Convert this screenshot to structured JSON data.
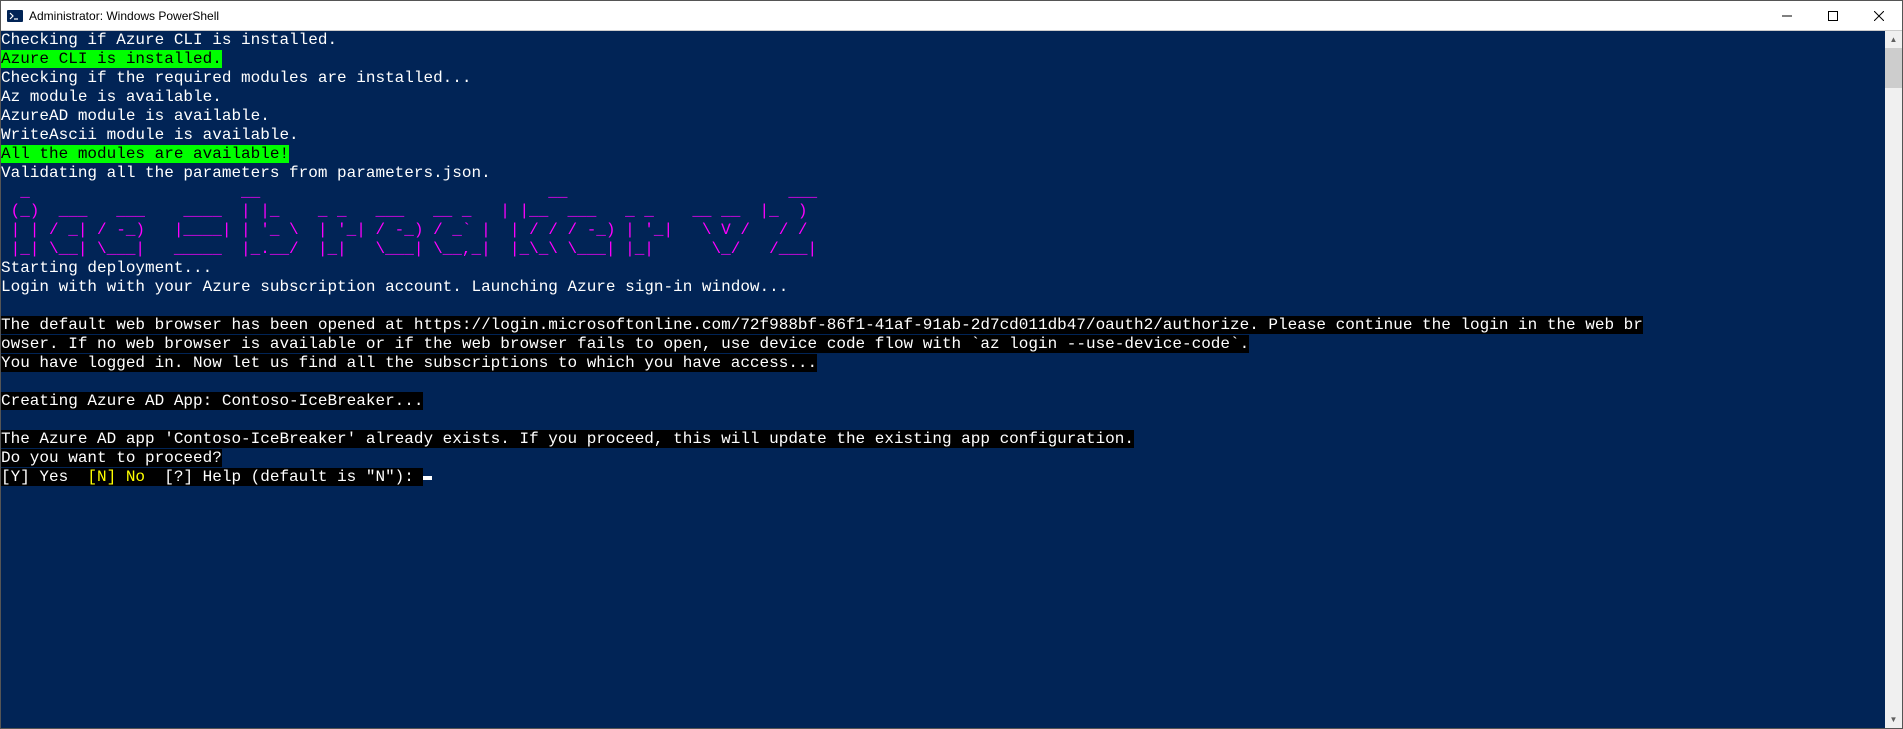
{
  "window": {
    "title": "Administrator: Windows PowerShell"
  },
  "colors": {
    "terminal_bg": "#012456",
    "terminal_fg": "#ffffff",
    "highlight_green_bg": "#00ff00",
    "highlight_green_fg": "#000000",
    "magenta": "#ff00ff",
    "black_bg": "#000000",
    "yellow": "#ffff00"
  },
  "lines": {
    "l1": "Checking if Azure CLI is installed.",
    "l2": "Azure CLI is installed.",
    "l3": "Checking if the required modules are installed...",
    "l4": "Az module is available.",
    "l5": "AzureAD module is available.",
    "l6": "WriteAscii module is available.",
    "l7": "All the modules are available!",
    "l8": "Validating all the parameters from parameters.json.",
    "ascii1": "  _                      __                              __                       ___  ",
    "ascii2": " (_)  ___   ___    ____  | |_    _ _   ___   __ _   | |__  ___   _ _    __ __  |_  ) ",
    "ascii3": " | | / _| / -_)   |____| | '_ \\  | '_| / -_) / _` |  | / / / -_) | '_|   \\ V /   / /  ",
    "ascii4": " |_| \\__| \\___|   _____  |_.__/  |_|   \\___| \\__,_|  |_\\_\\ \\___| |_|      \\_/   /___| ",
    "l9": "Starting deployment...",
    "l10": "Login with with your Azure subscription account. Launching Azure sign-in window...",
    "l11": "The default web browser has been opened at https://login.microsoftonline.com/72f988bf-86f1-41af-91ab-2d7cd011db47/oauth2/authorize. Please continue the login in the web br",
    "l12": "owser. If no web browser is available or if the web browser fails to open, use device code flow with `az login --use-device-code`.",
    "l13": "You have logged in. Now let us find all the subscriptions to which you have access...",
    "l14": "Creating Azure AD App: Contoso-IceBreaker...",
    "l15": "The Azure AD app 'Contoso-IceBreaker' already exists. If you proceed, this will update the existing app configuration.",
    "l16": "Do you want to proceed?",
    "prompt_y": "[Y] Yes  ",
    "prompt_n": "[N] No",
    "prompt_rest": "  [?] Help (default is \"N\"): "
  }
}
